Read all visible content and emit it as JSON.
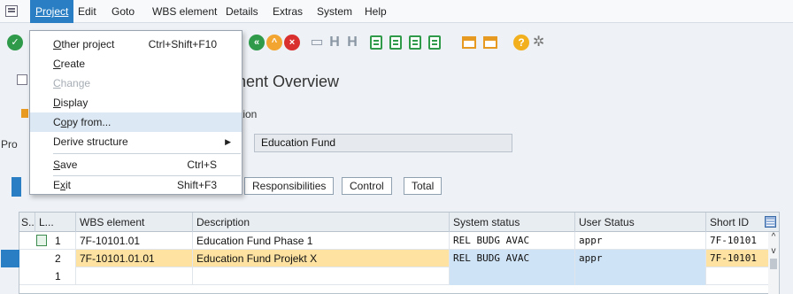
{
  "menu": {
    "items": [
      "Project",
      "Edit",
      "Goto",
      "WBS element",
      "Details",
      "Extras",
      "System",
      "Help"
    ]
  },
  "dropdown": {
    "items": [
      {
        "label": "Other project",
        "shortcut": "Ctrl+Shift+F10"
      },
      {
        "label": "Create",
        "shortcut": ""
      },
      {
        "label": "Change",
        "shortcut": ""
      },
      {
        "label": "Display",
        "shortcut": ""
      },
      {
        "label": "Copy from...",
        "shortcut": ""
      },
      {
        "label": "Derive structure",
        "shortcut": ""
      },
      {
        "label": "Save",
        "shortcut": "Ctrl+S"
      },
      {
        "label": "Exit",
        "shortcut": "Shift+F3"
      }
    ]
  },
  "title": {
    "text": "nent Overview"
  },
  "app_toolbar": {
    "text": "tion"
  },
  "fields": {
    "project_label": "Pro",
    "project_description": "Education Fund"
  },
  "tabs": [
    "Responsibilities",
    "Control",
    "Total"
  ],
  "table": {
    "headers": [
      "S..",
      "L...",
      "WBS element",
      "Description",
      "System status",
      "User Status",
      "Short ID"
    ],
    "rows": [
      {
        "level": "1",
        "wbs": "7F-10101.01",
        "description": "Education Fund Phase 1",
        "system_status": "REL  BUDG AVAC",
        "user_status": "appr",
        "short_id": "7F-10101"
      },
      {
        "level": "2",
        "wbs": "7F-10101.01.01",
        "description": "Education Fund Projekt X",
        "system_status": "REL  BUDG AVAC",
        "user_status": "appr",
        "short_id": "7F-10101"
      },
      {
        "level": "1",
        "wbs": "",
        "description": "",
        "system_status": "",
        "user_status": "",
        "short_id": ""
      }
    ]
  },
  "icons": {
    "toolbar": [
      "enter-icon",
      "back-icon",
      "exit-icon",
      "cancel-icon",
      "print-icon",
      "find-icon",
      "find-next-icon",
      "first-page-icon",
      "previous-page-icon",
      "next-page-icon",
      "last-page-icon",
      "new-session-icon",
      "shortcut-icon",
      "help-icon",
      "settings-icon"
    ]
  }
}
